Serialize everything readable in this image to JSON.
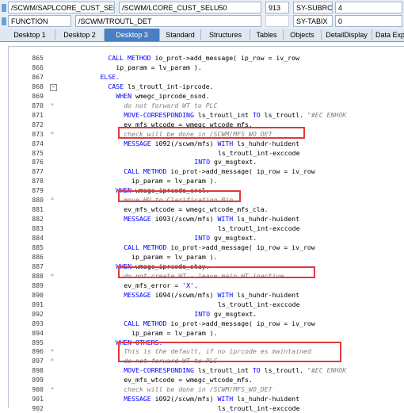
{
  "header": {
    "program_1": "/SCWM/SAPLCORE_CUST_SEL",
    "include_1": "/SCWM/LCORE_CUST_SELU50",
    "line_1": "913",
    "var_1": "SY-SUBRC",
    "val_1": "4",
    "type_2": "FUNCTION",
    "name_2": "/SCWM/TROUTL_DET",
    "var_2": "SY-TABIX",
    "val_2": "0"
  },
  "tabs": [
    "Desktop 1",
    "Desktop 2",
    "Desktop 3",
    "Standard",
    "Structures",
    "Tables",
    "Objects",
    "DetailDisplay",
    "Data Exp"
  ],
  "active_tab": "Desktop 3",
  "lines": [
    {
      "n": "865",
      "ind": 12,
      "parts": [
        [
          "kw",
          "CALL METHOD "
        ],
        [
          "",
          "io_prot->add_message( ip_row = iv_row"
        ]
      ]
    },
    {
      "n": "866",
      "ind": 14,
      "parts": [
        [
          "",
          "ip_param = lv_param )."
        ]
      ]
    },
    {
      "n": "867",
      "ind": 10,
      "parts": [
        [
          "kw",
          "ELSE."
        ]
      ]
    },
    {
      "n": "868",
      "ind": 12,
      "fold": true,
      "parts": [
        [
          "kw",
          "CASE "
        ],
        [
          "",
          "ls_troutl_int-iprcode."
        ]
      ]
    },
    {
      "n": "869",
      "ind": 14,
      "parts": [
        [
          "kw",
          "WHEN "
        ],
        [
          "",
          "wmegc_iprcode_nsnd."
        ]
      ]
    },
    {
      "n": "870",
      "ind": 16,
      "c": true,
      "parts": [
        [
          "cm",
          "do not forward WT to PLC"
        ]
      ]
    },
    {
      "n": "871",
      "ind": 16,
      "parts": [
        [
          "kw",
          "MOVE-CORRESPONDING "
        ],
        [
          "",
          "ls_troutl_int "
        ],
        [
          "kw",
          "TO "
        ],
        [
          "",
          "ls_troutl. "
        ],
        [
          "cm",
          "\"#EC ENHOK"
        ]
      ]
    },
    {
      "n": "872",
      "ind": 16,
      "parts": [
        [
          "",
          "ev_mfs_wtcode = wmegc_wtcode_mfs."
        ]
      ]
    },
    {
      "n": "873",
      "ind": 16,
      "c": true,
      "parts": [
        [
          "cm",
          "check will be done in /SCWM/MFS_WO_DET"
        ]
      ]
    },
    {
      "n": "874",
      "ind": 16,
      "parts": [
        [
          "kw",
          "MESSAGE "
        ],
        [
          "",
          "i092(/scwm/mfs) "
        ],
        [
          "kw",
          "WITH "
        ],
        [
          "",
          "ls_huhdr-huident"
        ]
      ]
    },
    {
      "n": "875",
      "ind": 40,
      "parts": [
        [
          "",
          "ls_troutl_int-exccode"
        ]
      ]
    },
    {
      "n": "876",
      "ind": 34,
      "parts": [
        [
          "kw",
          "INTO "
        ],
        [
          "",
          "gv_msgtext."
        ]
      ]
    },
    {
      "n": "877",
      "ind": 16,
      "parts": [
        [
          "kw",
          "CALL METHOD "
        ],
        [
          "",
          "io_prot->add_message( ip_row = iv_row"
        ]
      ]
    },
    {
      "n": "878",
      "ind": 18,
      "parts": [
        [
          "",
          "ip_param = lv_param )."
        ]
      ]
    },
    {
      "n": "879",
      "ind": 14,
      "parts": [
        [
          "kw",
          "WHEN "
        ],
        [
          "",
          "wmegc_iprcode_crcl."
        ]
      ]
    },
    {
      "n": "880",
      "ind": 16,
      "c": true,
      "parts": [
        [
          "cm",
          "move HU to Clarification Bin"
        ]
      ]
    },
    {
      "n": "881",
      "ind": 16,
      "parts": [
        [
          "",
          "ev_mfs_wtcode = wmegc_wtcode_mfs_cla."
        ]
      ]
    },
    {
      "n": "882",
      "ind": 16,
      "parts": [
        [
          "kw",
          "MESSAGE "
        ],
        [
          "",
          "i093(/scwm/mfs) "
        ],
        [
          "kw",
          "WITH "
        ],
        [
          "",
          "ls_huhdr-huident"
        ]
      ]
    },
    {
      "n": "883",
      "ind": 40,
      "parts": [
        [
          "",
          "ls_troutl_int-exccode"
        ]
      ]
    },
    {
      "n": "884",
      "ind": 34,
      "parts": [
        [
          "kw",
          "INTO "
        ],
        [
          "",
          "gv_msgtext."
        ]
      ]
    },
    {
      "n": "885",
      "ind": 16,
      "parts": [
        [
          "kw",
          "CALL METHOD "
        ],
        [
          "",
          "io_prot->add_message( ip_row = iv_row"
        ]
      ]
    },
    {
      "n": "886",
      "ind": 18,
      "parts": [
        [
          "",
          "ip_param = lv_param )."
        ]
      ]
    },
    {
      "n": "887",
      "ind": 14,
      "parts": [
        [
          "kw",
          "WHEN "
        ],
        [
          "",
          "wmegc_iprcode_stay."
        ]
      ]
    },
    {
      "n": "888",
      "ind": 16,
      "c": true,
      "parts": [
        [
          "cm",
          "do not create WT - leave main WT inactive"
        ]
      ]
    },
    {
      "n": "889",
      "ind": 16,
      "parts": [
        [
          "",
          "ev_mfs_error = "
        ],
        [
          "pr",
          "'X'"
        ],
        [
          "",
          "."
        ]
      ]
    },
    {
      "n": "890",
      "ind": 16,
      "parts": [
        [
          "kw",
          "MESSAGE "
        ],
        [
          "",
          "i094(/scwm/mfs) "
        ],
        [
          "kw",
          "WITH "
        ],
        [
          "",
          "ls_huhdr-huident"
        ]
      ]
    },
    {
      "n": "891",
      "ind": 40,
      "parts": [
        [
          "",
          "ls_troutl_int-exccode"
        ]
      ]
    },
    {
      "n": "892",
      "ind": 34,
      "parts": [
        [
          "kw",
          "INTO "
        ],
        [
          "",
          "gv_msgtext."
        ]
      ]
    },
    {
      "n": "893",
      "ind": 16,
      "parts": [
        [
          "kw",
          "CALL METHOD "
        ],
        [
          "",
          "io_prot->add_message( ip_row = iv_row"
        ]
      ]
    },
    {
      "n": "894",
      "ind": 18,
      "parts": [
        [
          "",
          "ip_param = lv_param )."
        ]
      ]
    },
    {
      "n": "895",
      "ind": 14,
      "parts": [
        [
          "kw",
          "WHEN OTHERS."
        ]
      ]
    },
    {
      "n": "896",
      "ind": 16,
      "c": true,
      "parts": [
        [
          "cm",
          "This is the default, if no iprcode es maintained"
        ]
      ]
    },
    {
      "n": "897",
      "ind": 16,
      "c": true,
      "parts": [
        [
          "cm",
          "do not forward WT to PLC"
        ]
      ]
    },
    {
      "n": "898",
      "ind": 16,
      "parts": [
        [
          "kw",
          "MOVE-CORRESPONDING "
        ],
        [
          "",
          "ls_troutl_int "
        ],
        [
          "kw",
          "TO "
        ],
        [
          "",
          "ls_troutl. "
        ],
        [
          "cm",
          "\"#EC ENHOK"
        ]
      ]
    },
    {
      "n": "899",
      "ind": 16,
      "parts": [
        [
          "",
          "ev_mfs_wtcode = wmegc_wtcode_mfs."
        ]
      ]
    },
    {
      "n": "900",
      "ind": 16,
      "c": true,
      "parts": [
        [
          "cm",
          "check will be done in /SCWM/MFS_WO_DET"
        ]
      ]
    },
    {
      "n": "901",
      "ind": 16,
      "parts": [
        [
          "kw",
          "MESSAGE "
        ],
        [
          "",
          "i092(/scwm/mfs) "
        ],
        [
          "kw",
          "WITH "
        ],
        [
          "",
          "ls_huhdr-huident"
        ]
      ]
    },
    {
      "n": "902",
      "ind": 40,
      "parts": [
        [
          "",
          "ls_troutl_int-exccode"
        ]
      ]
    }
  ]
}
